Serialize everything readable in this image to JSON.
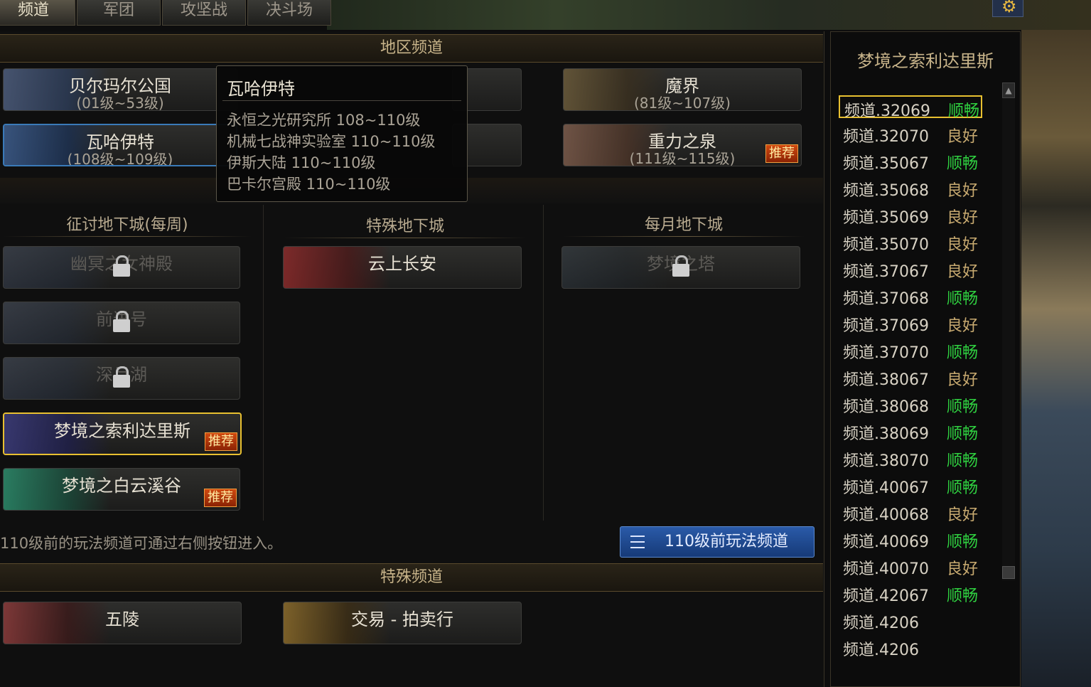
{
  "tabs": [
    "频道",
    "军团",
    "攻坚战",
    "决斗场"
  ],
  "regions": {
    "title": "地区频道",
    "items": [
      {
        "name": "贝尔玛尔公国",
        "levels": "(01级~53级)"
      },
      {
        "name": "魔界",
        "levels": "(81级~107级)"
      },
      {
        "name": "瓦哈伊特",
        "levels": "(108级~109级)"
      },
      {
        "name": "重力之泉",
        "levels": "(111级~115级)",
        "tag": "推荐"
      }
    ]
  },
  "tooltip": {
    "title": "瓦哈伊特",
    "rows": [
      "永恒之光研究所 108~110级",
      "机械七战神实验室 110~110级",
      "伊斯大陆 110~110级",
      "巴卡尔宫殿 110~110级"
    ]
  },
  "dungeons": {
    "columns": [
      {
        "title": "征讨地下城(每周)",
        "items": [
          {
            "name": "幽冥之女神殿",
            "locked": true
          },
          {
            "name": "前进号",
            "locked": true
          },
          {
            "name": "深月湖",
            "locked": true
          },
          {
            "name": "梦境之索利达里斯",
            "tag": "推荐",
            "selected": true
          },
          {
            "name": "梦境之白云溪谷",
            "tag": "推荐"
          }
        ]
      },
      {
        "title": "特殊地下城",
        "items": [
          {
            "name": "云上长安"
          }
        ]
      },
      {
        "title": "每月地下城",
        "items": [
          {
            "name": "梦境之塔",
            "locked": true
          }
        ]
      }
    ]
  },
  "hint": "110级前的玩法频道可通过右侧按钮进入。",
  "pre110_button": "110级前玩法频道",
  "special": {
    "title": "特殊频道",
    "items": [
      {
        "name": "五陵"
      },
      {
        "name": "交易 - 拍卖行"
      }
    ]
  },
  "channel_panel": {
    "title": "梦境之索利达里斯",
    "channels": [
      {
        "name": "频道.32069",
        "status": "顺畅"
      },
      {
        "name": "频道.32070",
        "status": "良好"
      },
      {
        "name": "频道.35067",
        "status": "顺畅"
      },
      {
        "name": "频道.35068",
        "status": "良好"
      },
      {
        "name": "频道.35069",
        "status": "良好"
      },
      {
        "name": "频道.35070",
        "status": "良好"
      },
      {
        "name": "频道.37067",
        "status": "良好"
      },
      {
        "name": "频道.37068",
        "status": "顺畅"
      },
      {
        "name": "频道.37069",
        "status": "良好"
      },
      {
        "name": "频道.37070",
        "status": "顺畅"
      },
      {
        "name": "频道.38067",
        "status": "良好"
      },
      {
        "name": "频道.38068",
        "status": "顺畅"
      },
      {
        "name": "频道.38069",
        "status": "顺畅"
      },
      {
        "name": "频道.38070",
        "status": "顺畅"
      },
      {
        "name": "频道.40067",
        "status": "顺畅"
      },
      {
        "name": "频道.40068",
        "status": "良好"
      },
      {
        "name": "频道.40069",
        "status": "顺畅"
      },
      {
        "name": "频道.40070",
        "status": "良好"
      },
      {
        "name": "频道.42067",
        "status": "顺畅"
      },
      {
        "name": "频道.4206",
        "status": ""
      },
      {
        "name": "频道.4206",
        "status": ""
      }
    ],
    "status_colors": {
      "顺畅": "#2fd040",
      "良好": "#c8aa70"
    }
  },
  "icons": {
    "settings": "gear-icon",
    "lock": "lock-icon",
    "menu": "menu-icon"
  }
}
